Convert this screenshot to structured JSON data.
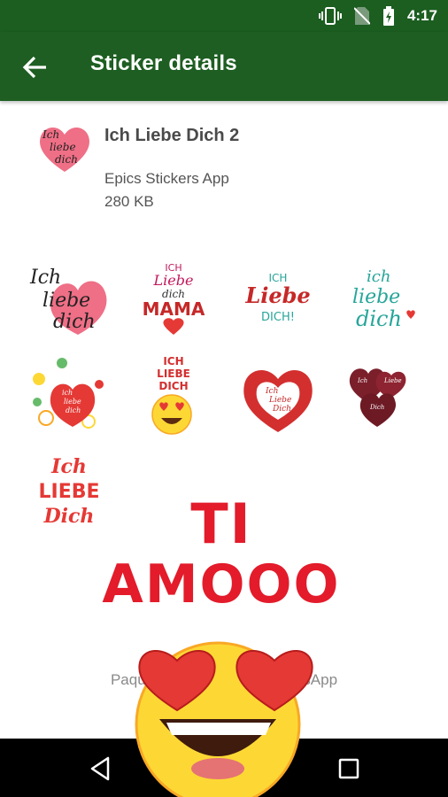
{
  "status_bar": {
    "time": "4:17",
    "icons": [
      "vibrate-icon",
      "no-sim-icon",
      "battery-charging-icon"
    ]
  },
  "app_bar": {
    "title": "Sticker details",
    "back_icon": "arrow-back-icon"
  },
  "pack": {
    "name": "Ich Liebe Dich 2",
    "publisher": "Epics Stickers App",
    "size": "280 KB"
  },
  "stickers": [
    {
      "lines": [
        "Ich",
        "liebe",
        "dich"
      ]
    },
    {
      "lines": [
        "ICH",
        "Liebe",
        "dich",
        "MAMA"
      ]
    },
    {
      "lines": [
        "ICH",
        "Liebe",
        "DICH!"
      ]
    },
    {
      "lines": [
        "ich",
        "liebe",
        "dich"
      ]
    },
    {
      "lines": [
        "ich",
        "liebe",
        "dich"
      ]
    },
    {
      "lines": [
        "ICH",
        "LIEBE",
        "DICH"
      ]
    },
    {
      "lines": [
        "Ich",
        "Liebe",
        "Dich"
      ]
    },
    {
      "lines": [
        "Ich",
        "Liebe",
        "Dich"
      ]
    },
    {
      "lines": [
        "Ich",
        "LIEBE",
        "Dich"
      ]
    }
  ],
  "footer_note": "Paquete de stickers de WhatsApp",
  "overlay_sticker": {
    "line1": "TI",
    "line2": "AMOOO"
  },
  "nav_bar": {
    "buttons": [
      "back-triangle-icon",
      "home-circle-icon",
      "recents-square-icon"
    ]
  },
  "colors": {
    "status_bar": "#1b5e20",
    "app_bar": "#1e5e22",
    "accent_red": "#e31b2a"
  }
}
